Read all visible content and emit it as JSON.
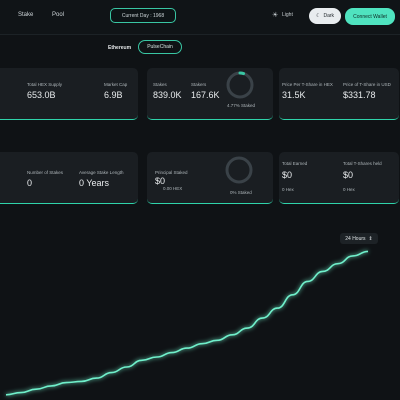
{
  "nav": {
    "stake": "Stake",
    "pool": "Pool"
  },
  "header": {
    "day_label": "Current Day : 1968",
    "light_label": "Light",
    "dark_label": "Dark",
    "connect_label": "Connect Wallet"
  },
  "chain": {
    "label": "Ethereum",
    "selected": "PulseChain"
  },
  "row1": {
    "card_a": {
      "label1": "Total HEX Supply",
      "value1": "653.0B",
      "label2": "Market Cap",
      "value2": "6.9B"
    },
    "card_b": {
      "label1": "Stakes",
      "value1": "839.0K",
      "label2": "Stakers",
      "value2": "167.6K",
      "ring_label": "4.77% Staked",
      "ring_fraction": 0.0477
    },
    "card_c": {
      "label1": "Price Per T-Share in HEX",
      "value1": "31.5K",
      "label2": "Price of T-Share in USD",
      "value2": "$331.78"
    }
  },
  "row2": {
    "card_a": {
      "label1": "Number of Stakes",
      "value1": "0",
      "label2": "Average Stake Length",
      "value2": "0 Years"
    },
    "card_b": {
      "label1": "Principal Staked",
      "value1": "$0",
      "sub1": "0.00 HEX",
      "ring_label": "0% Staked",
      "ring_fraction": 0
    },
    "card_c": {
      "label1": "Total Earned",
      "value1": "$0",
      "sub1": "0 Hex",
      "label2": "Total T-Shares held",
      "value2": "$0",
      "sub2": "0 Hex"
    }
  },
  "chart": {
    "range_label": "24 Hours",
    "line_color": "#6ff0cb"
  },
  "chart_data": {
    "type": "line",
    "x": [
      0,
      1,
      2,
      3,
      4,
      5,
      6,
      7,
      8,
      9,
      10,
      11,
      12,
      13,
      14,
      15,
      16,
      17,
      18,
      19,
      20,
      21,
      22,
      23,
      24
    ],
    "values": [
      2,
      4,
      7,
      10,
      13,
      14,
      17,
      22,
      27,
      33,
      36,
      40,
      44,
      48,
      51,
      56,
      62,
      71,
      80,
      92,
      104,
      113,
      120,
      127,
      131
    ],
    "ylim": [
      0,
      135
    ],
    "title": "",
    "xlabel": "",
    "ylabel": ""
  }
}
